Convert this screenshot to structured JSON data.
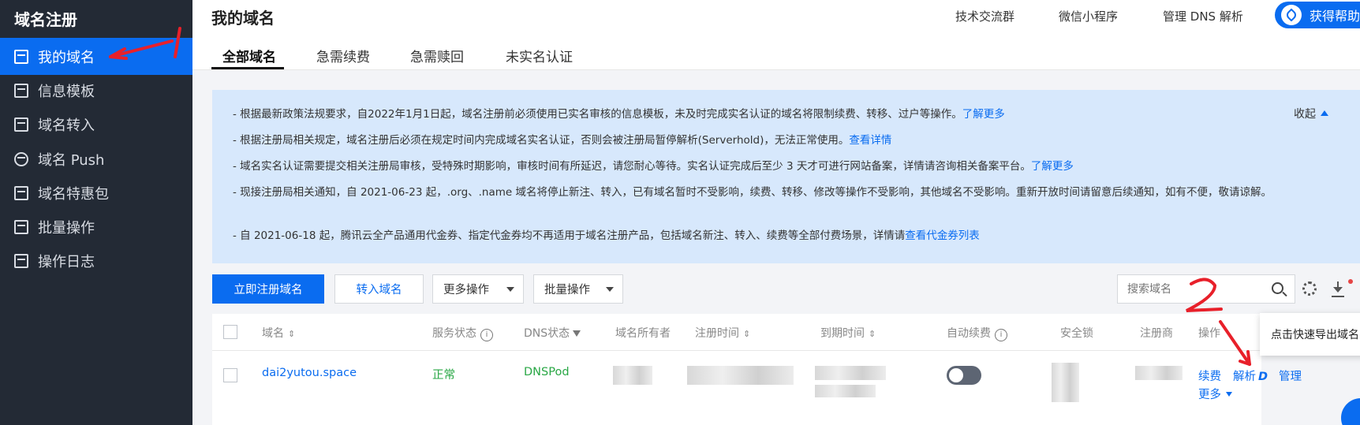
{
  "sidebar": {
    "title": "域名注册",
    "items": [
      {
        "label": "我的域名",
        "icon": "domain-icon",
        "active": true
      },
      {
        "label": "信息模板",
        "icon": "template-icon"
      },
      {
        "label": "域名转入",
        "icon": "transfer-in-icon"
      },
      {
        "label": "域名 Push",
        "icon": "push-icon"
      },
      {
        "label": "域名特惠包",
        "icon": "gift-package-icon"
      },
      {
        "label": "批量操作",
        "icon": "batch-icon"
      },
      {
        "label": "操作日志",
        "icon": "log-icon"
      }
    ]
  },
  "header": {
    "title": "我的域名",
    "links": [
      "技术交流群",
      "微信小程序",
      "管理 DNS 解析"
    ],
    "help_button": "获得帮助"
  },
  "tabs": [
    "全部域名",
    "急需续费",
    "急需赎回",
    "未实名认证"
  ],
  "notice": {
    "collapse_label": "收起",
    "lines": [
      {
        "text": "- 根据最新政策法规要求，自2022年1月1日起，域名注册前必须使用已实名审核的信息模板，未及时完成实名认证的域名将限制续费、转移、过户等操作。",
        "link": "了解更多"
      },
      {
        "text": "- 根据注册局相关规定，域名注册后必须在规定时间内完成域名实名认证，否则会被注册局暂停解析(Serverhold)，无法正常使用。",
        "link": "查看详情"
      },
      {
        "text": "- 域名实名认证需要提交相关注册局审核，受特殊时期影响，审核时间有所延迟，请您耐心等待。实名认证完成后至少 3 天才可进行网站备案，详情请咨询相关备案平台。",
        "link": "了解更多"
      },
      {
        "text": "- 现接注册局相关通知，自 2021-06-23 起，.org、.name 域名将停止新注、转入，已有域名暂时不受影响，续费、转移、修改等操作不受影响，其他域名不受影响。重新开放时间请留意后续通知，如有不便，敬请谅解。",
        "link": ""
      },
      {
        "text": "- 自 2021-06-18 起，腾讯云全产品通用代金券、指定代金券均不再适用于域名注册产品，包括域名新注、转入、续费等全部付费场景，详情请",
        "link": "查看代金券列表"
      }
    ]
  },
  "toolbar": {
    "register_button": "立即注册域名",
    "transfer_button": "转入域名",
    "more_ops_select": "更多操作",
    "batch_ops_select": "批量操作",
    "search_placeholder": "搜索域名",
    "export_tooltip": "点击快速导出域名"
  },
  "table": {
    "columns": [
      "域名",
      "服务状态",
      "DNS状态",
      "域名所有者",
      "注册时间",
      "到期时间",
      "自动续费",
      "安全锁",
      "注册商",
      "操作"
    ],
    "rows": [
      {
        "domain": "dai2yutou.space",
        "service_status": "正常",
        "dns_status": "DNSPod",
        "auto_renew": false,
        "actions": {
          "renew": "续费",
          "resolve": "解析",
          "manage": "管理",
          "more": "更多"
        }
      }
    ]
  },
  "annotations": [
    "1",
    "2"
  ],
  "colors": {
    "sidebar_bg": "#232a35",
    "accent": "#0a6cf0",
    "notice_bg": "#d7e8fc",
    "status_green": "#29a745",
    "annotation_red": "#e8202a"
  }
}
